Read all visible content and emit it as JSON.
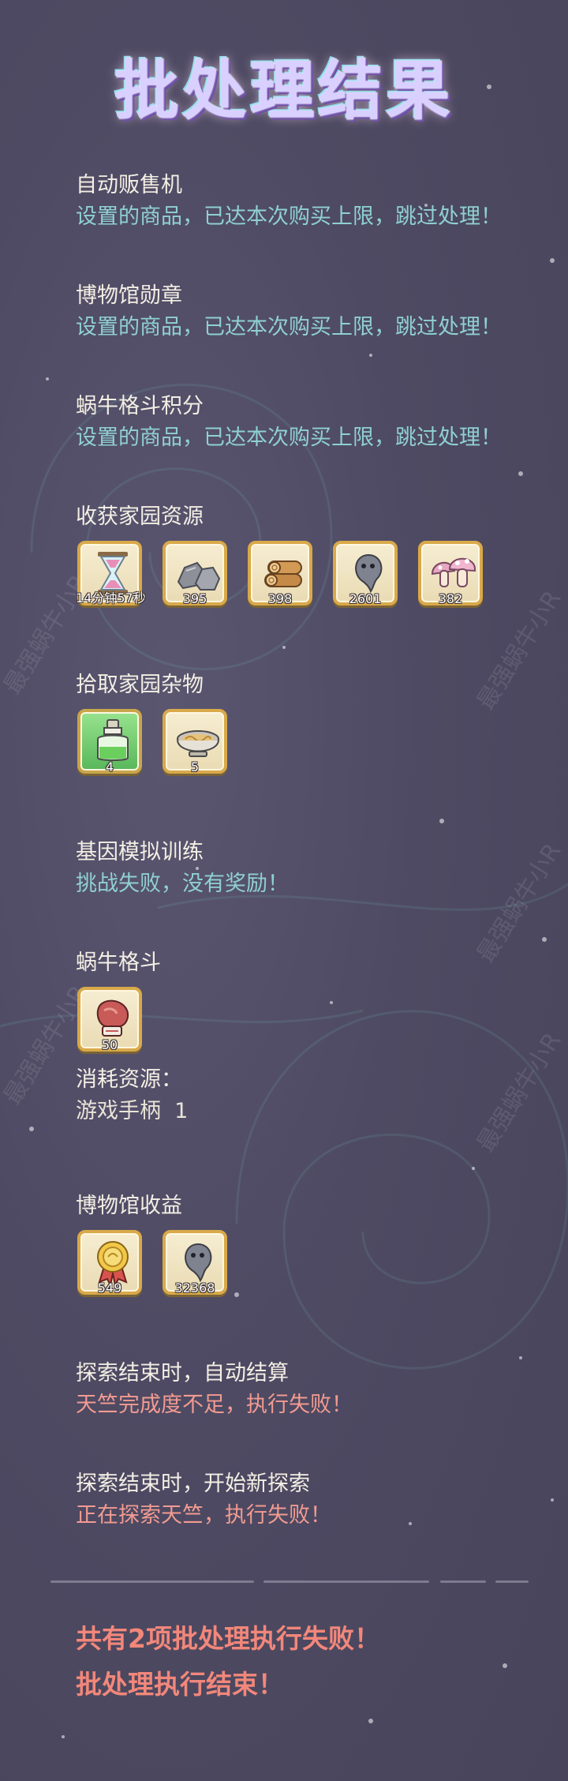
{
  "title": "批处理结果",
  "watermark": "最强蜗牛小R",
  "colors": {
    "background": "#4e4a63",
    "info_text": "#8fd0d2",
    "error_text": "#f29b91",
    "item_border": "#d9a94a"
  },
  "sections": {
    "vending": {
      "title": "自动贩售机",
      "message": "设置的商品，已达本次购买上限，跳过处理！"
    },
    "museum_medal": {
      "title": "博物馆勋章",
      "message": "设置的商品，已达本次购买上限，跳过处理！"
    },
    "snail_points": {
      "title": "蜗牛格斗积分",
      "message": "设置的商品，已达本次购买上限，跳过处理！"
    },
    "harvest": {
      "title": "收获家园资源",
      "items": [
        {
          "icon": "hourglass-icon",
          "qty": "14分钟57秒"
        },
        {
          "icon": "stone-icon",
          "qty": "395"
        },
        {
          "icon": "wood-logs-icon",
          "qty": "398"
        },
        {
          "icon": "tadpole-icon",
          "qty": "2601"
        },
        {
          "icon": "mushroom-icon",
          "qty": "382"
        }
      ]
    },
    "pickup": {
      "title": "拾取家园杂物",
      "items": [
        {
          "icon": "potion-bottle-icon",
          "qty": "4"
        },
        {
          "icon": "noodle-bowl-icon",
          "qty": "5"
        }
      ]
    },
    "gene": {
      "title": "基因模拟训练",
      "message": "挑战失败，没有奖励！"
    },
    "fight": {
      "title": "蜗牛格斗",
      "items": [
        {
          "icon": "boxing-glove-icon",
          "qty": "50"
        }
      ],
      "consume_label": "消耗资源：",
      "consume_item": "游戏手柄  1"
    },
    "museum_income": {
      "title": "博物馆收益",
      "items": [
        {
          "icon": "medal-icon",
          "qty": "549"
        },
        {
          "icon": "tadpole-icon",
          "qty": "32368"
        }
      ]
    },
    "explore_settle": {
      "title": "探索结束时，自动结算",
      "message": "天竺完成度不足，执行失败！"
    },
    "explore_new": {
      "title": "探索结束时，开始新探索",
      "message": "正在探索天竺，执行失败！"
    }
  },
  "summary": {
    "failed": "共有2项批处理执行失败！",
    "done": "批处理执行结束！"
  }
}
